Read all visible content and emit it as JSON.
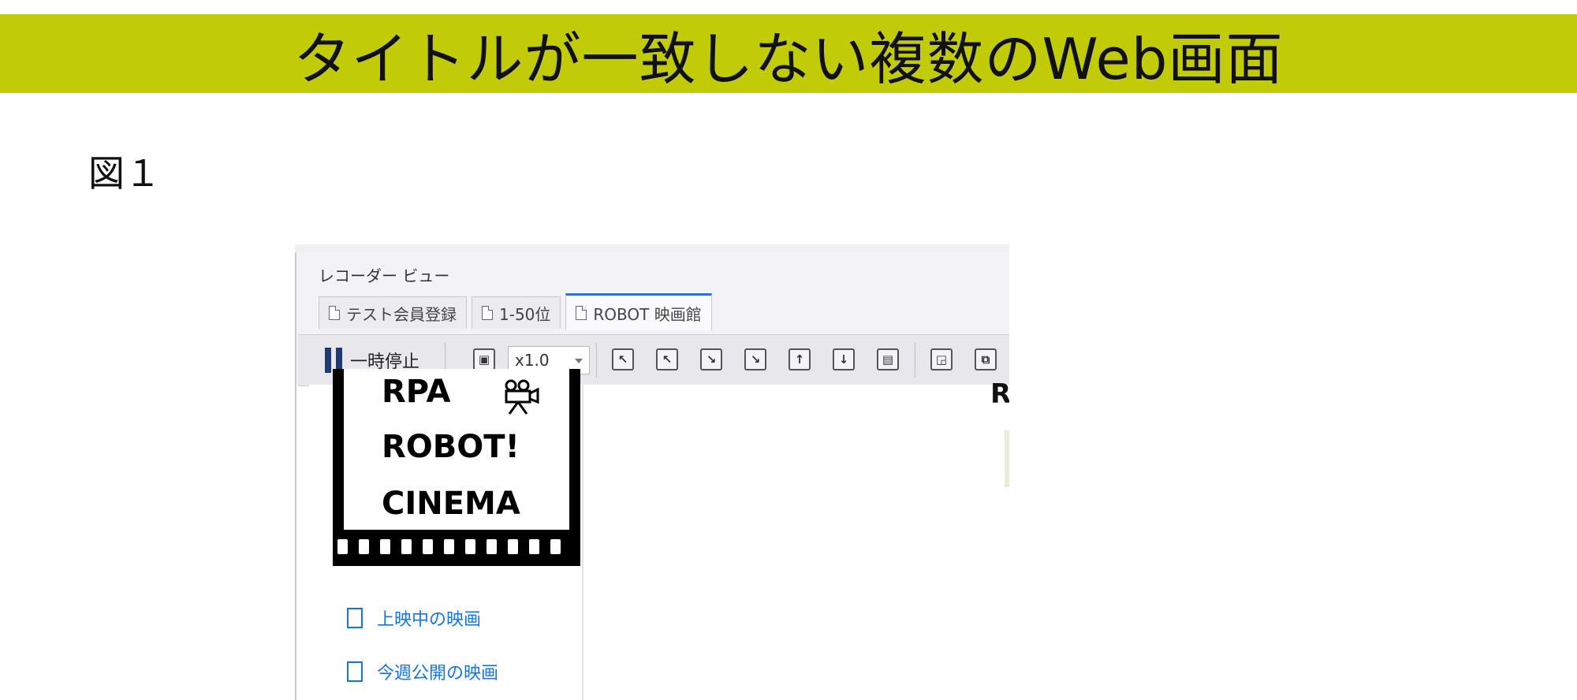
{
  "slide": {
    "title": "タイトルが一致しない複数のWeb画面",
    "figure_label": "図１"
  },
  "recorder": {
    "title": "レコーダー ビュー",
    "tabs": [
      {
        "label": "テスト会員登録",
        "active": false
      },
      {
        "label": "1-50位",
        "active": false
      },
      {
        "label": "ROBOT 映画館",
        "active": true
      }
    ],
    "toolbar": {
      "pause_label": "一時停止",
      "speed_value": "x1.0"
    }
  },
  "webpage": {
    "logo_lines": [
      "RPA",
      "ROBOT!",
      "CINEMA"
    ],
    "nav_items": [
      {
        "label": "上映中の映画"
      },
      {
        "label": "今週公開の映画"
      }
    ],
    "content_fragment": "R"
  },
  "colors": {
    "title_band": "#c2cb07",
    "link": "#1a73d9",
    "active_tab_accent": "#3a6fc9",
    "pause_icon": "#213a73"
  }
}
